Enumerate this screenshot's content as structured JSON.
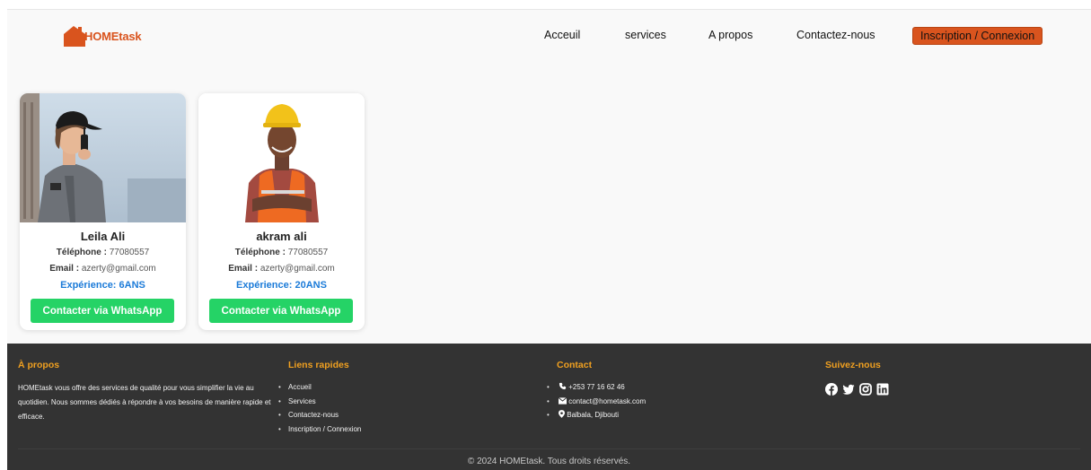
{
  "header": {
    "logo_text": "HOMEtask",
    "nav": [
      "Acceuil",
      "services",
      "A propos",
      "Contactez-nous",
      "Inscription / Connexion"
    ]
  },
  "workers": [
    {
      "name": "Leila Ali",
      "phone_label": "Téléphone :",
      "phone": "77080557",
      "email_label": "Email :",
      "email": "azerty@gmail.com",
      "experience": "Expérience: 6ANS",
      "button": "Contacter via WhatsApp"
    },
    {
      "name": "akram ali",
      "phone_label": "Téléphone :",
      "phone": "77080557",
      "email_label": "Email :",
      "email": "azerty@gmail.com",
      "experience": "Expérience: 20ANS",
      "button": "Contacter via WhatsApp"
    }
  ],
  "footer": {
    "about": {
      "title": "À propos",
      "text": "HOMEtask vous offre des services de qualité pour vous simplifier la vie au quotidien. Nous sommes dédiés à répondre à vos besoins de manière rapide et efficace."
    },
    "links": {
      "title": "Liens rapides",
      "items": [
        "Accueil",
        "Services",
        "Contactez-nous",
        "Inscription / Connexion"
      ]
    },
    "contact": {
      "title": "Contact",
      "phone": "+253 77 16 62 46",
      "email": "contact@hometask.com",
      "address": "Balbala, Djibouti"
    },
    "social": {
      "title": "Suivez-nous",
      "icons": [
        "facebook-icon",
        "twitter-icon",
        "instagram-icon",
        "linkedin-icon"
      ]
    },
    "copyright": "© 2024 HOMEtask. Tous droits réservés."
  },
  "colors": {
    "brand": "#d9541e",
    "whatsapp": "#25d366",
    "experience": "#1a7ad8",
    "footer_bg": "#333333",
    "footer_title": "#f0a020"
  }
}
